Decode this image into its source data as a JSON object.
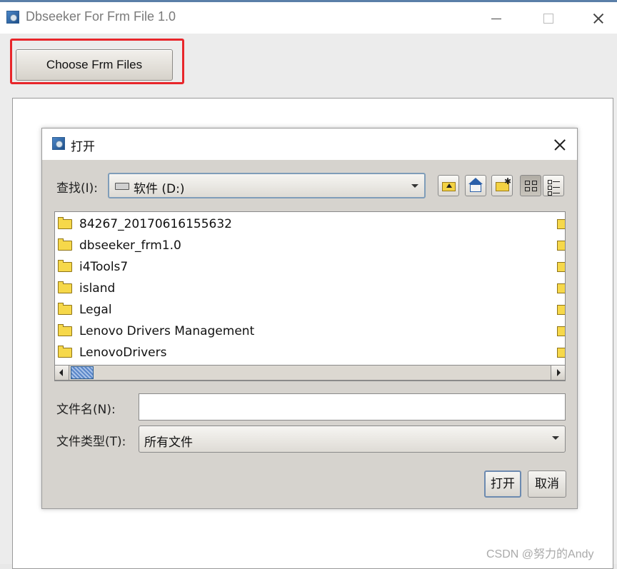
{
  "window": {
    "title": "Dbseeker For Frm File 1.0"
  },
  "main": {
    "choose_button_label": "Choose Frm Files"
  },
  "dialog": {
    "title": "打开",
    "look_in_label": "查找(I):",
    "look_in_value": "软件 (D:)",
    "files": [
      "84267_20170616155632",
      "dbseeker_frm1.0",
      "i4Tools7",
      "island",
      "Legal",
      "Lenovo Drivers Management",
      "LenovoDrivers"
    ],
    "file_name_label": "文件名(N):",
    "file_name_value": "",
    "file_type_label": "文件类型(T):",
    "file_type_value": "所有文件",
    "open_button_label": "打开",
    "cancel_button_label": "取消"
  },
  "watermark": "CSDN @努力的Andy",
  "colors": {
    "highlight": "#e8262b",
    "dialog_bg": "#d6d3ce",
    "folder": "#f6d84a"
  }
}
